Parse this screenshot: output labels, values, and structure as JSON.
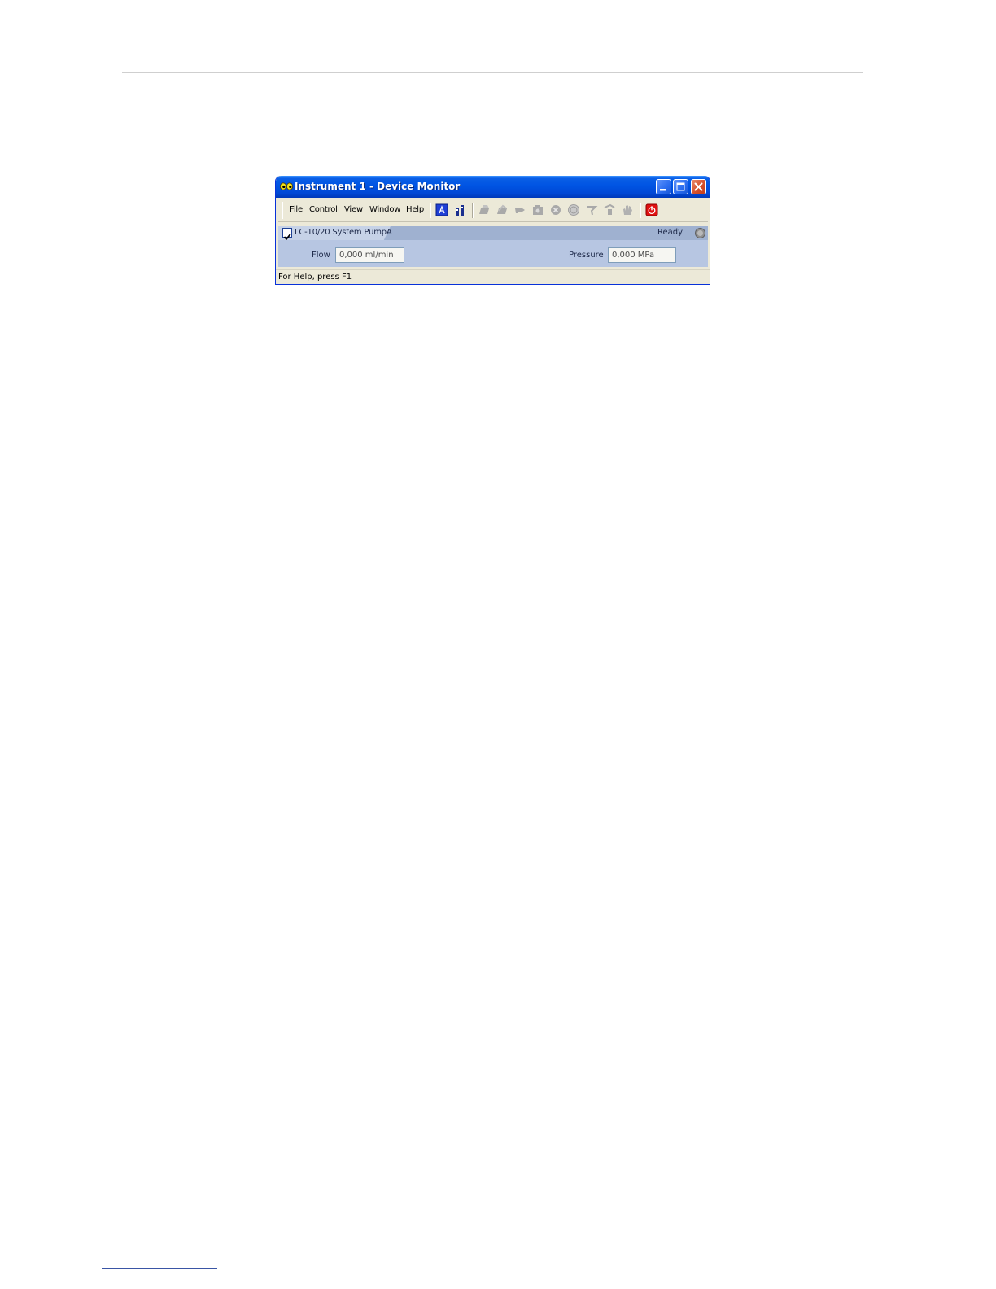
{
  "window": {
    "title": "Instrument 1 - Device Monitor"
  },
  "menu": {
    "items": [
      "File",
      "Control",
      "View",
      "Window",
      "Help"
    ]
  },
  "toolbar": {
    "icons": [
      "auto-icon",
      "monitor-icon",
      "download-icon",
      "upload-icon",
      "pointer-icon",
      "camera-icon",
      "stop-icon",
      "standby-icon",
      "purge-icon",
      "sampler-icon",
      "hand-icon",
      "power-icon"
    ]
  },
  "device": {
    "name": "LC-10/20 System PumpA",
    "status": "Ready",
    "flow": {
      "label": "Flow",
      "value": "0,000 ml/min"
    },
    "pressure": {
      "label": "Pressure",
      "value": "0,000 MPa"
    }
  },
  "statusbar": {
    "text": "For Help, press F1"
  },
  "colors": {
    "titlebar": "#0054e3",
    "panel": "#b7c6e2",
    "close_button": "#d5512c"
  }
}
